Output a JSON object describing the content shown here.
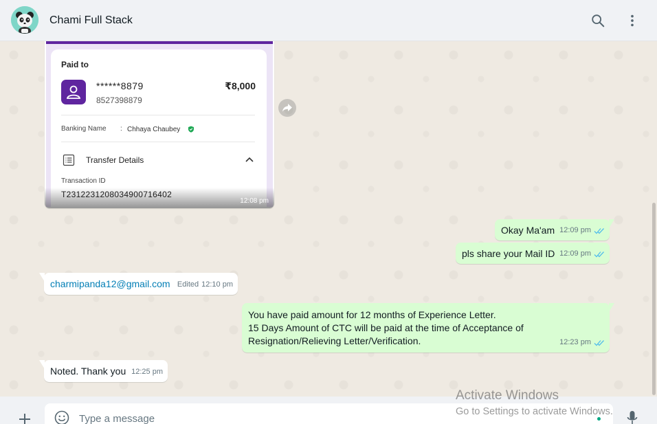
{
  "header": {
    "contact_name": "Chami Full Stack",
    "icons": [
      "search-icon",
      "menu-dots-icon"
    ]
  },
  "payment_card": {
    "paid_to_label": "Paid to",
    "account_masked": "******8879",
    "phone": "8527398879",
    "amount": "₹8,000",
    "banking_name_label": "Banking Name",
    "banking_name_colon": ":",
    "banking_name": "Chhaya  Chaubey",
    "transfer_details_label": "Transfer Details",
    "transaction_id_label": "Transaction ID",
    "transaction_id": "T2312231208034900716402",
    "time": "12:08 pm",
    "brand_color": "#5f259f"
  },
  "messages": [
    {
      "direction": "out",
      "text": "Okay Ma'am",
      "time": "12:09 pm",
      "status": "read"
    },
    {
      "direction": "out",
      "text": "pls share your Mail ID",
      "time": "12:09 pm",
      "status": "read"
    },
    {
      "direction": "in",
      "text": "charmipanda12@gmail.com",
      "edited_label": "Edited",
      "time": "12:10 pm"
    },
    {
      "direction": "out",
      "text": "You have paid amount for 12 months of Experience Letter.\n15 Days Amount of CTC will be paid at the time of Acceptance of Resignation/Relieving Letter/Verification.",
      "time": "12:23 pm",
      "status": "read"
    },
    {
      "direction": "in",
      "text": "Noted. Thank you",
      "time": "12:25 pm"
    }
  ],
  "composer": {
    "placeholder": "Type a message"
  },
  "watermark": {
    "title": "Activate Windows",
    "subtitle": "Go to Settings to activate Windows."
  },
  "colors": {
    "outgoing_bubble": "#d9fdd3",
    "incoming_bubble": "#ffffff",
    "read_ticks": "#53bdeb",
    "link": "#027eb5"
  }
}
